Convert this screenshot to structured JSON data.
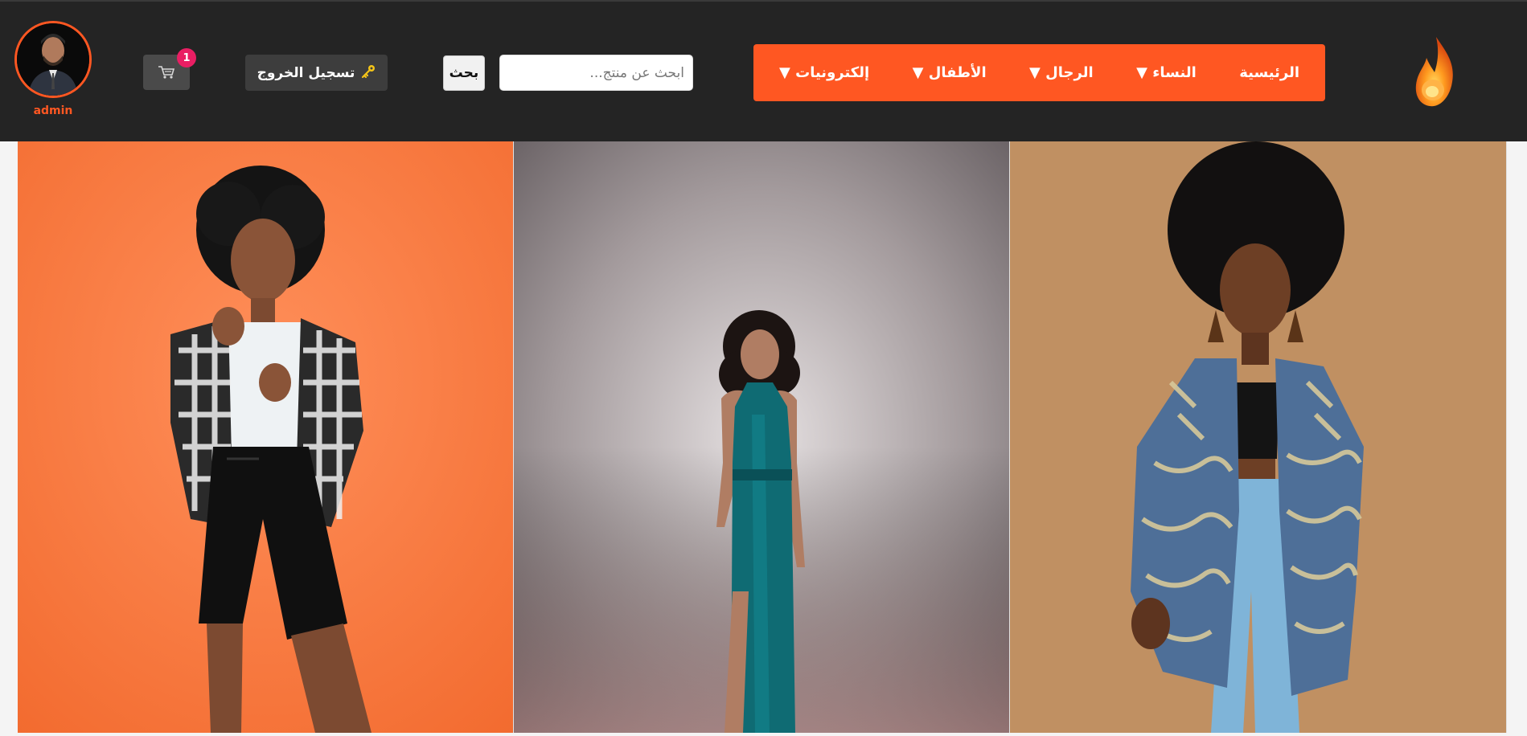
{
  "header": {
    "user": {
      "name": "admin"
    },
    "cart": {
      "count": "1"
    },
    "logout": {
      "label": "تسجيل الخروج"
    },
    "search": {
      "button_label": "بحث",
      "placeholder": "ابحث عن منتج..."
    },
    "nav": [
      {
        "label": "الرئيسية"
      },
      {
        "label": "النساء ▼"
      },
      {
        "label": "الرجال ▼"
      },
      {
        "label": "الأطفال ▼"
      },
      {
        "label": "إلكترونيات ▼"
      }
    ]
  },
  "colors": {
    "accent": "#ff5722",
    "topbar": "#242424",
    "badge": "#e91e63"
  },
  "icons": {
    "cart": "cart-icon",
    "logout": "key-icon",
    "logo": "fire-logo-icon"
  },
  "hero": {
    "panels": [
      {
        "name": "orange-backdrop-photo"
      },
      {
        "name": "teal-dress-photo"
      },
      {
        "name": "patterned-shirt-photo"
      }
    ]
  }
}
